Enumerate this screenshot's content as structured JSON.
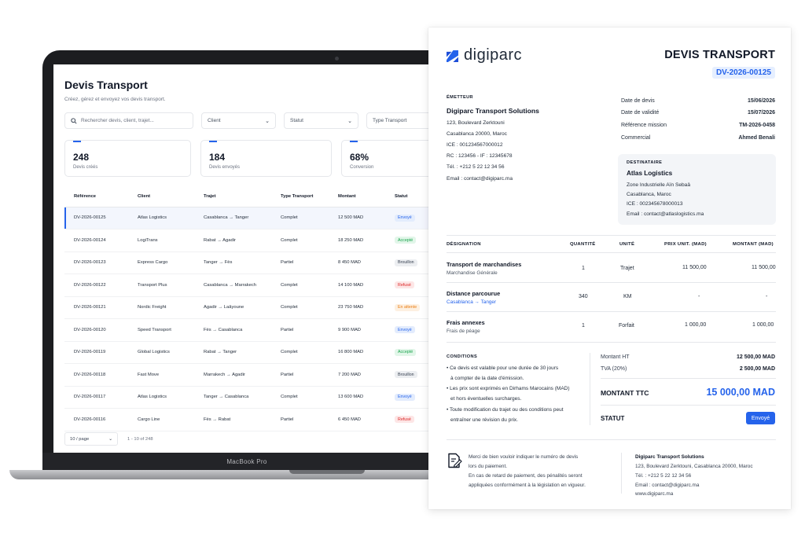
{
  "app": {
    "title": "Devis Transport",
    "subtitle": "Créez, gérez et envoyez vos devis transport.",
    "search_placeholder": "Rechercher devis, client, trajet...",
    "filters": [
      "Client",
      "Statut",
      "Type Transport"
    ],
    "stats": [
      {
        "value": "248",
        "label": "Devis créés"
      },
      {
        "value": "184",
        "label": "Devis envoyés"
      },
      {
        "value": "68%",
        "label": "Conversion"
      }
    ],
    "columns": [
      "Référence",
      "Client",
      "Trajet",
      "Type Transport",
      "Montant",
      "Statut"
    ],
    "rows": [
      {
        "ref": "DV-2026-00125",
        "client": "Atlas Logistics",
        "trajet": "Casablanca → Tanger",
        "type": "Complet",
        "montant": "12 500 MAD",
        "statut": "Envoyé"
      },
      {
        "ref": "DV-2026-00124",
        "client": "LogiTrans",
        "trajet": "Rabat → Agadir",
        "type": "Complet",
        "montant": "18 250 MAD",
        "statut": "Accepté"
      },
      {
        "ref": "DV-2026-00123",
        "client": "Express Cargo",
        "trajet": "Tanger → Fès",
        "type": "Partiel",
        "montant": "8 450 MAD",
        "statut": "Brouillon"
      },
      {
        "ref": "DV-2026-00122",
        "client": "Transport Plus",
        "trajet": "Casablanca → Marrakech",
        "type": "Complet",
        "montant": "14 100 MAD",
        "statut": "Refusé"
      },
      {
        "ref": "DV-2026-00121",
        "client": "Nordic Freight",
        "trajet": "Agadir → Laâyoune",
        "type": "Complet",
        "montant": "23 750 MAD",
        "statut": "En attente"
      },
      {
        "ref": "DV-2026-00120",
        "client": "Speed Transport",
        "trajet": "Fès → Casablanca",
        "type": "Partiel",
        "montant": "9 900 MAD",
        "statut": "Envoyé"
      },
      {
        "ref": "DV-2026-00119",
        "client": "Global Logistics",
        "trajet": "Rabat → Tanger",
        "type": "Complet",
        "montant": "16 800 MAD",
        "statut": "Accepté"
      },
      {
        "ref": "DV-2026-00118",
        "client": "Fast Move",
        "trajet": "Marrakech → Agadir",
        "type": "Partiel",
        "montant": "7 200 MAD",
        "statut": "Brouillon"
      },
      {
        "ref": "DV-2026-00117",
        "client": "Atlas Logistics",
        "trajet": "Tanger → Casablanca",
        "type": "Complet",
        "montant": "13 600 MAD",
        "statut": "Envoyé"
      },
      {
        "ref": "DV-2026-00116",
        "client": "Cargo Line",
        "trajet": "Fès → Rabat",
        "type": "Partiel",
        "montant": "6 450 MAD",
        "statut": "Refusé"
      }
    ],
    "status_colors": {
      "Envoyé": {
        "bg": "#e3ecfd",
        "fg": "#2563eb"
      },
      "Accepté": {
        "bg": "#e2f6e9",
        "fg": "#16a34a"
      },
      "Brouillon": {
        "bg": "#eceef1",
        "fg": "#374151"
      },
      "Refusé": {
        "bg": "#fde6e6",
        "fg": "#dc2626"
      },
      "En attente": {
        "bg": "#fdf0e1",
        "fg": "#ea7c12"
      }
    },
    "page_size": "10 / page",
    "page_info": "1 - 10 of 248"
  },
  "laptop_label": "MacBook Pro",
  "doc": {
    "logo_text": "digiparc",
    "title": "DEVIS TRANSPORT",
    "number": "DV-2026-00125",
    "emetteur": {
      "label": "ÉMETTEUR",
      "name": "Digiparc Transport Solutions",
      "lines": [
        "123, Boulevard Zerktouni",
        "Casablanca 20000, Maroc",
        "ICE : 001234567000012",
        "RC : 123456 - IF : 12345678",
        "Tél. : +212 5 22 12 34 56",
        "Email : contact@digiparc.ma"
      ]
    },
    "meta": [
      {
        "label": "Date de devis",
        "value": "15/06/2026"
      },
      {
        "label": "Date de validité",
        "value": "15/07/2026"
      },
      {
        "label": "Référence mission",
        "value": "TM-2026-0458"
      },
      {
        "label": "Commercial",
        "value": "Ahmed Benali"
      }
    ],
    "destinataire": {
      "label": "DESTINATAIRE",
      "name": "Atlas Logistics",
      "lines": [
        "Zone Industrielle Aïn Sebaâ",
        "Casablanca, Maroc",
        "ICE : 002345678000013",
        "Email : contact@atlaslogistics.ma"
      ]
    },
    "columns": [
      "DÉSIGNATION",
      "QUANTITÉ",
      "UNITÉ",
      "PRIX UNIT. (MAD)",
      "MONTANT (MAD)"
    ],
    "items": [
      {
        "name": "Transport de marchandises",
        "sub": "Marchandise Générale",
        "qty": "1",
        "unit": "Trajet",
        "price": "11 500,00",
        "amount": "11 500,00"
      },
      {
        "name": "Distance parcourue",
        "sub": "Casablanca → Tanger",
        "qty": "340",
        "unit": "KM",
        "price": "-",
        "amount": "-"
      },
      {
        "name": "Frais annexes",
        "sub": "Frais de péage",
        "qty": "1",
        "unit": "Forfait",
        "price": "1 000,00",
        "amount": "1 000,00"
      }
    ],
    "conditions": {
      "label": "CONDITIONS",
      "lines": [
        "• Ce devis est valable pour une durée de 30 jours",
        "à compter de la date d'émission.",
        "• Les prix sont exprimés en Dirhams Marocains (MAD)",
        "et hors éventuelles surcharges.",
        "• Toute modification du trajet ou des conditions peut",
        "entraîner une révision du prix."
      ]
    },
    "totals": {
      "ht_label": "Montant HT",
      "ht_value": "12 500,00 MAD",
      "tva_label": "TVA (20%)",
      "tva_value": "2 500,00 MAD",
      "ttc_label": "MONTANT TTC",
      "ttc_value": "15 000,00 MAD",
      "statut_label": "STATUT",
      "statut_value": "Envoyé"
    },
    "footer": {
      "note_lines": [
        "Merci de bien vouloir indiquer le numéro de devis",
        "lors du paiement.",
        "En cas de retard de paiement, des pénalités seront",
        "appliquées conformément à la législation en vigueur."
      ],
      "company": "Digiparc Transport Solutions",
      "company_lines": [
        "123, Boulevard Zerktouni, Casablanca 20000, Maroc",
        "Tél. : +212 5 22 12 34 56",
        "Email : contact@digiparc.ma",
        "www.digiparc.ma"
      ]
    }
  }
}
